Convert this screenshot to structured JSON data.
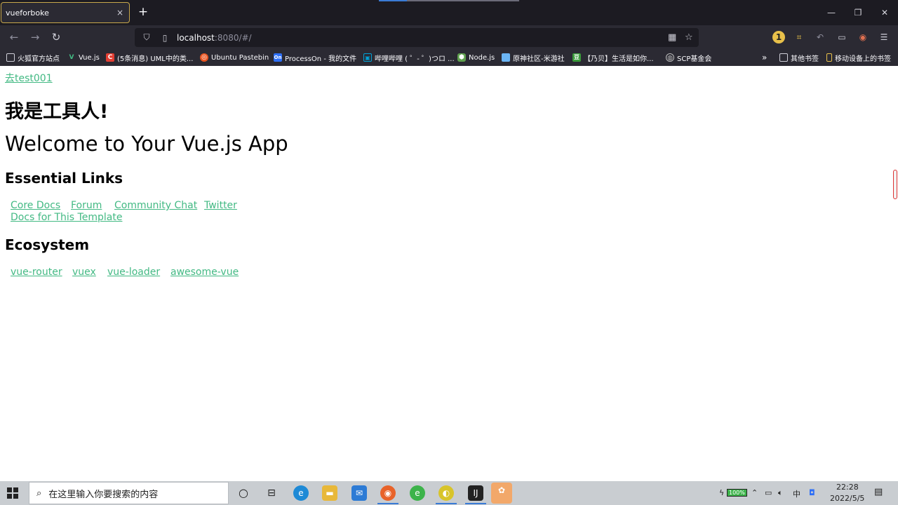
{
  "browser": {
    "tab_title": "vueforboke",
    "tab_close": "×",
    "new_tab": "+",
    "url_host": "localhost",
    "url_rest": ":8080/#/",
    "win_minimize": "—",
    "win_restore": "❐",
    "win_close": "✕"
  },
  "bookmarks": [
    {
      "label": "火狐官方站点",
      "icon": "folder-icon",
      "color": "#e8c04a"
    },
    {
      "label": "Vue.js",
      "icon": "vue-icon",
      "color": "#42b983"
    },
    {
      "label": "(5条消息) UML中的类...",
      "icon": "csdn-icon",
      "color": "#e33e33"
    },
    {
      "label": "Ubuntu Pastebin",
      "icon": "ubuntu-icon",
      "color": "#e95420"
    },
    {
      "label": "ProcessOn - 我的文件",
      "icon": "processon-icon",
      "color": "#2d6ff7"
    },
    {
      "label": "哔哩哔哩 ( ゜- ゜)つロ ...",
      "icon": "bilibili-icon",
      "color": "#00a1d6"
    },
    {
      "label": "Node.js",
      "icon": "nodejs-icon",
      "color": "#5fa04e"
    },
    {
      "label": "原神社区-米游社",
      "icon": "miyoushe-icon",
      "color": "#6bb5f5"
    },
    {
      "label": "【乃贝】生活是如你...",
      "icon": "douban-icon",
      "color": "#3a9b3a"
    },
    {
      "label": "SCP基金会",
      "icon": "scp-icon",
      "color": "#bbbbbb"
    },
    {
      "label": "其他书签",
      "icon": "folder-icon",
      "color": "#cfcfd8"
    },
    {
      "label": "移动设备上的书签",
      "icon": "mobile-icon",
      "color": "#e8c04a"
    }
  ],
  "page": {
    "link_test": "去test001",
    "heading_tool": "我是工具人!",
    "heading_welcome": "Welcome to Your Vue.js App",
    "heading_essential": "Essential Links",
    "essential_links": [
      "Core Docs",
      "Forum",
      "Community Chat",
      "Twitter",
      "Docs for This Template"
    ],
    "heading_ecosystem": "Ecosystem",
    "ecosystem_links": [
      "vue-router",
      "vuex",
      "vue-loader",
      "awesome-vue"
    ]
  },
  "taskbar": {
    "search_placeholder": "在这里输入你要搜索的内容",
    "battery": "100%",
    "time": "22:28",
    "date": "2022/5/5",
    "ime": "中"
  }
}
